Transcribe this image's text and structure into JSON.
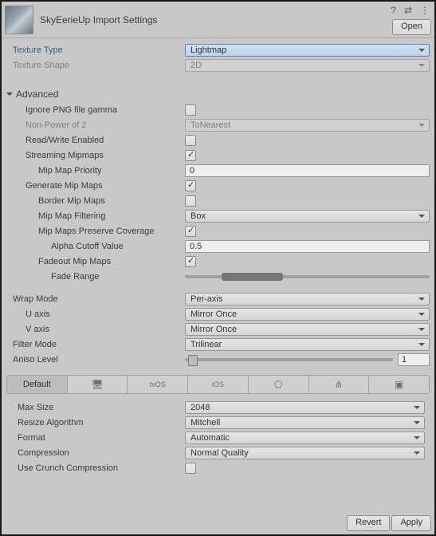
{
  "header": {
    "title": "SkyEerieUp Import Settings",
    "open_label": "Open",
    "icons": {
      "help": "?",
      "preset": "⇄",
      "menu": "⋮"
    }
  },
  "top": {
    "texture_type_label": "Texture Type",
    "texture_type_value": "Lightmap",
    "texture_shape_label": "Texture Shape",
    "texture_shape_value": "2D"
  },
  "advanced": {
    "title": "Advanced",
    "ignore_png_label": "Ignore PNG file gamma",
    "ignore_png_checked": false,
    "npot_label": "Non-Power of 2",
    "npot_value": "ToNearest",
    "rw_label": "Read/Write Enabled",
    "rw_checked": false,
    "stream_label": "Streaming Mipmaps",
    "stream_checked": true,
    "mip_priority_label": "Mip Map Priority",
    "mip_priority_value": "0",
    "gen_label": "Generate Mip Maps",
    "gen_checked": true,
    "border_label": "Border Mip Maps",
    "border_checked": false,
    "filter_label": "Mip Map Filtering",
    "filter_value": "Box",
    "preserve_label": "Mip Maps Preserve Coverage",
    "preserve_checked": true,
    "alpha_cut_label": "Alpha Cutoff Value",
    "alpha_cut_value": "0.5",
    "fadeout_label": "Fadeout Mip Maps",
    "fadeout_checked": true,
    "fade_range_label": "Fade Range"
  },
  "wrap": {
    "wrap_label": "Wrap Mode",
    "wrap_value": "Per-axis",
    "u_label": "U axis",
    "u_value": "Mirror Once",
    "v_label": "V axis",
    "v_value": "Mirror Once",
    "filter_label": "Filter Mode",
    "filter_value": "Trilinear",
    "aniso_label": "Aniso Level",
    "aniso_value": "1"
  },
  "tabs": {
    "default": "Default",
    "icons": [
      "standalone",
      "tvos",
      "ios",
      "webgl",
      "android",
      "lumin"
    ]
  },
  "platform": {
    "max_size_label": "Max Size",
    "max_size_value": "2048",
    "resize_label": "Resize Algorithm",
    "resize_value": "Mitchell",
    "format_label": "Format",
    "format_value": "Automatic",
    "compression_label": "Compression",
    "compression_value": "Normal Quality",
    "crunch_label": "Use Crunch Compression",
    "crunch_checked": false
  },
  "footer": {
    "revert": "Revert",
    "apply": "Apply"
  }
}
